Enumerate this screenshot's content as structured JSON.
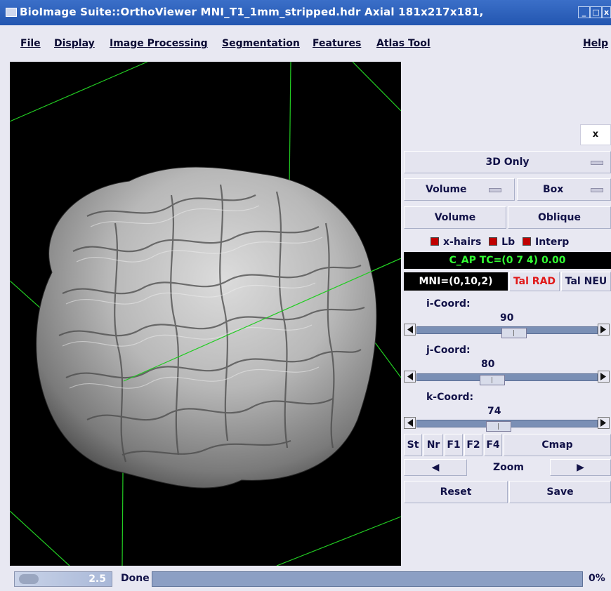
{
  "window": {
    "title": "BioImage Suite::OrthoViewer MNI_T1_1mm_stripped.hdr Axial 181x217x181,",
    "minimize": "_",
    "maximize": "□",
    "close": "x"
  },
  "menu": {
    "items": [
      "File",
      "Display",
      "Image Processing",
      "Segmentation",
      "Features",
      "Atlas Tool"
    ],
    "help": "Help"
  },
  "panel": {
    "close_label": "x",
    "mode_select": "3D Only",
    "volume_select": "Volume",
    "box_select": "Box",
    "volume_button": "Volume",
    "oblique_button": "Oblique",
    "checkboxes": {
      "xhairs": "x-hairs",
      "lb": "Lb",
      "interp": "Interp"
    },
    "coord_display": "C_AP TC=(0 7 4) 0.00",
    "mni_display": "MNI=(0,10,2)",
    "tal_rad": "Tal RAD",
    "tal_neu": "Tal NEU",
    "sliders": [
      {
        "label": "i-Coord:",
        "value": "90",
        "fraction": 0.54
      },
      {
        "label": "j-Coord:",
        "value": "80",
        "fraction": 0.4
      },
      {
        "label": "k-Coord:",
        "value": "74",
        "fraction": 0.44
      }
    ],
    "small_buttons": [
      "St",
      "Nr",
      "F1",
      "F2",
      "F4"
    ],
    "cmap": "Cmap",
    "zoom_prev": "◀",
    "zoom_label": "Zoom",
    "zoom_next": "▶",
    "reset": "Reset",
    "save": "Save"
  },
  "status": {
    "zoom_value": "2.5",
    "message": "Done",
    "progress_text": "0%",
    "progress": 0
  },
  "colors": {
    "viewport_bg": "#000000",
    "axis_lines": "#22cc22",
    "coord_bg": "#000000",
    "coord_fg": "#33ff33",
    "tal_rad_fg": "#e01818",
    "checkbox": "#c00000"
  }
}
